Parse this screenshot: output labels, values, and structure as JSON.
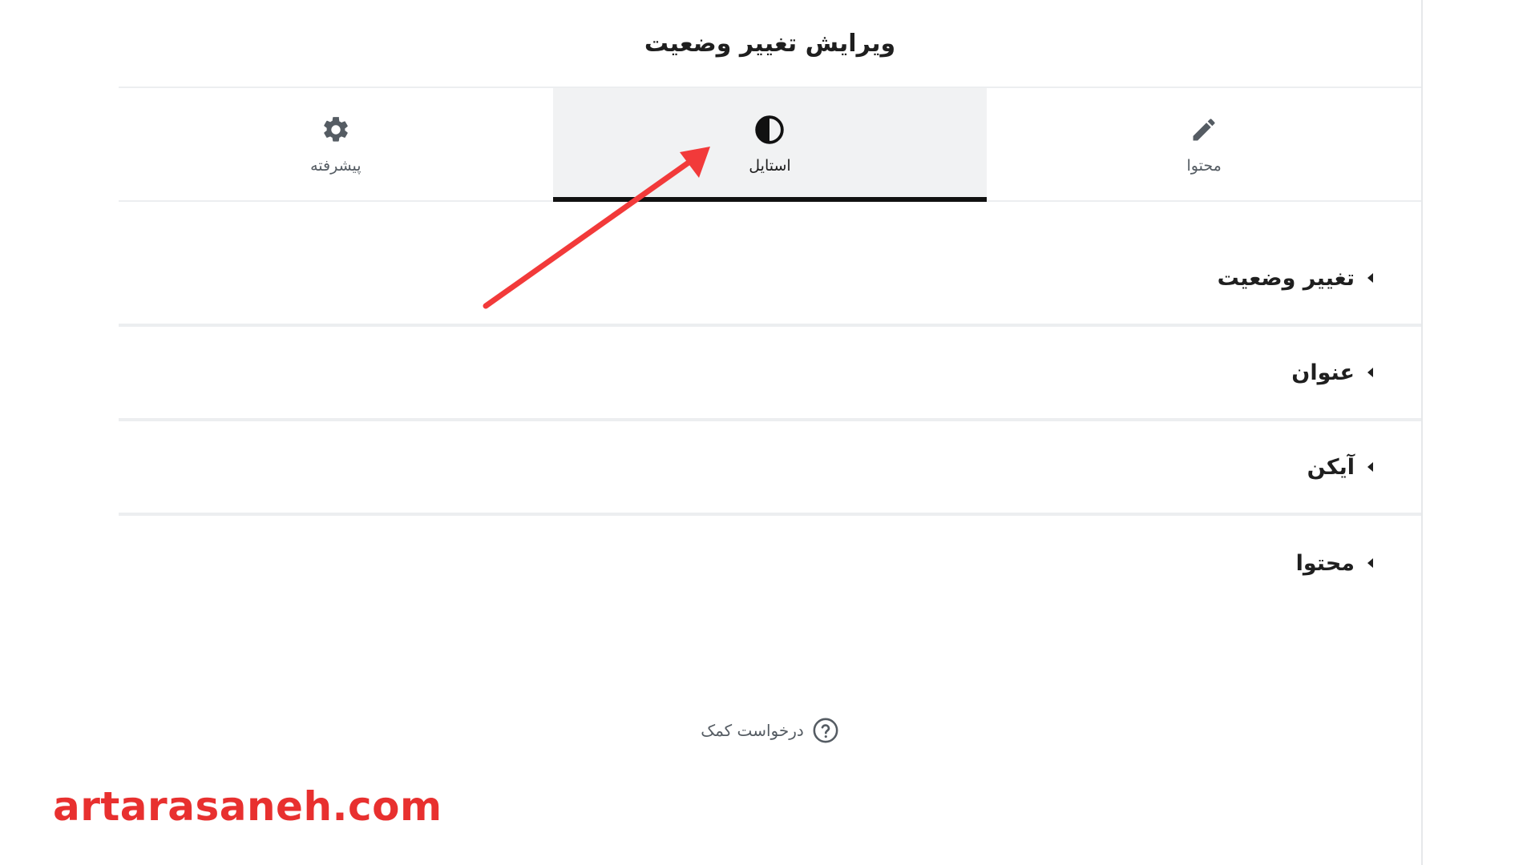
{
  "panel": {
    "title": "ویرایش تغییر وضعیت"
  },
  "tabs": [
    {
      "label": "محتوا",
      "icon": "pencil-icon",
      "active": false
    },
    {
      "label": "استایل",
      "icon": "half-circle-icon",
      "active": true
    },
    {
      "label": "پیشرفته",
      "icon": "gear-icon",
      "active": false
    }
  ],
  "sections": [
    {
      "label": "تغییر وضعیت",
      "icon": "caret-left-icon"
    },
    {
      "label": "عنوان",
      "icon": "caret-left-icon"
    },
    {
      "label": "آیکن",
      "icon": "caret-left-icon"
    },
    {
      "label": "محتوا",
      "icon": "caret-left-icon"
    }
  ],
  "help": {
    "label": "درخواست کمک",
    "icon": "question-circle-icon"
  },
  "watermark": {
    "text": "artarasaneh.com",
    "color": "#e8302f"
  },
  "annotation": {
    "icon": "red-arrow-icon",
    "color": "#f23a3a"
  },
  "colors": {
    "active_tab_bg": "#f1f2f3",
    "active_tab_indicator": "#111111",
    "text_muted": "#555c63"
  }
}
